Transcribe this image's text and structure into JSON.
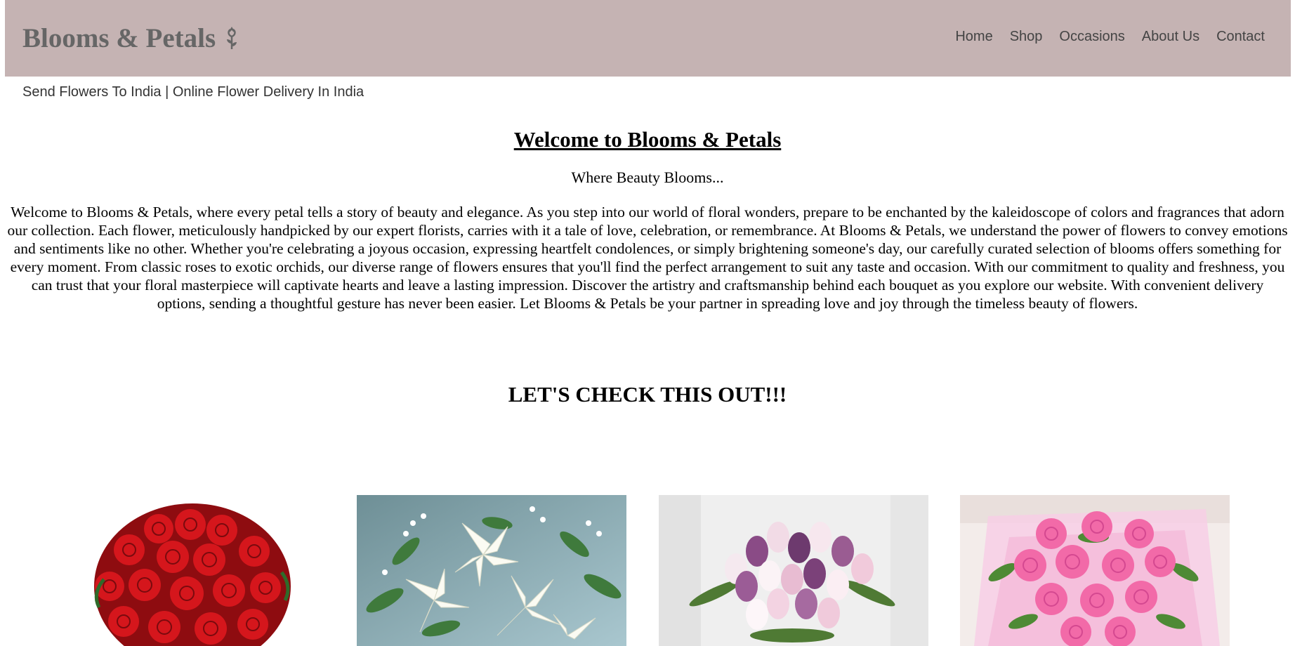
{
  "header": {
    "brand": "Blooms & Petals",
    "brand_icon": "flower-icon",
    "nav": [
      "Home",
      "Shop",
      "Occasions",
      "About Us",
      "Contact"
    ],
    "background_color": "#c5b3b3"
  },
  "tagline": "Send Flowers To India | Online Flower Delivery In India",
  "main": {
    "title": "Welcome to Blooms & Petals",
    "subtitle": "Where Beauty Blooms...",
    "intro": "Welcome to Blooms & Petals, where every petal tells a story of beauty and elegance. As you step into our world of floral wonders, prepare to be enchanted by the kaleidoscope of colors and fragrances that adorn our collection. Each flower, meticulously handpicked by our expert florists, carries with it a tale of love, celebration, or remembrance. At Blooms & Petals, we understand the power of flowers to convey emotions and sentiments like no other. Whether you're celebrating a joyous occasion, expressing heartfelt condolences, or simply brightening someone's day, our carefully curated selection of blooms offers something for every moment. From classic roses to exotic orchids, our diverse range of flowers ensures that you'll find the perfect arrangement to suit any taste and occasion. With our commitment to quality and freshness, you can trust that your floral masterpiece will captivate hearts and leave a lasting impression. Discover the artistry and craftsmanship behind each bouquet as you explore our website. With convenient delivery options, sending a thoughtful gesture has never been easier. Let Blooms & Petals be your partner in spreading love and joy through the timeless beauty of flowers.",
    "cta": "LET'S CHECK THIS OUT!!!"
  },
  "gallery": [
    {
      "image": "red-roses-bouquet",
      "color": "#c8141a"
    },
    {
      "image": "white-lilies-arrangement",
      "color": "#f4f4ec"
    },
    {
      "image": "purple-white-tulips",
      "color": "#b07aa8"
    },
    {
      "image": "pink-roses-bouquet",
      "color": "#f06aa6"
    }
  ]
}
